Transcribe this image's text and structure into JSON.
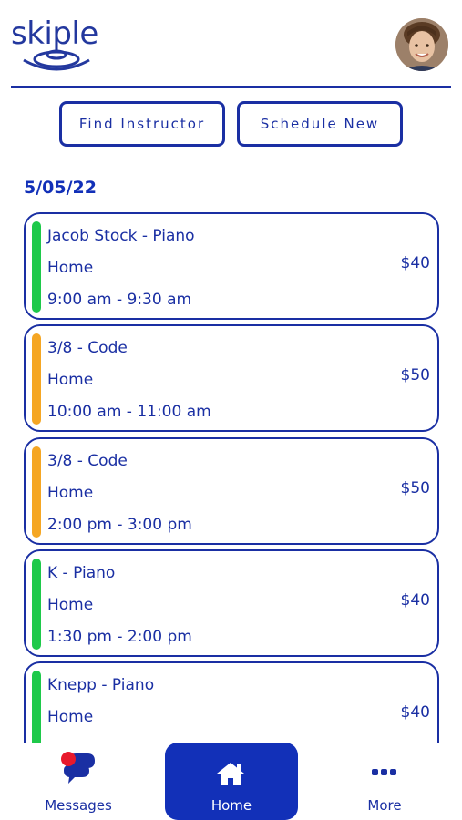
{
  "header": {
    "logo_text": "skiple",
    "avatar": "user-avatar"
  },
  "actions": {
    "find_instructor": "Find Instructor",
    "schedule_new": "Schedule New"
  },
  "date": "5/05/22",
  "appointments": [
    {
      "title": "Jacob Stock - Piano",
      "location": "Home",
      "time": "9:00 am - 9:30 am",
      "price": "$40",
      "status_color": "#1ec94a"
    },
    {
      "title": "3/8 - Code",
      "location": "Home",
      "time": "10:00 am - 11:00 am",
      "price": "$50",
      "status_color": "#f5a623"
    },
    {
      "title": "3/8 - Code",
      "location": "Home",
      "time": "2:00 pm - 3:00 pm",
      "price": "$50",
      "status_color": "#f5a623"
    },
    {
      "title": "K - Piano",
      "location": "Home",
      "time": "1:30 pm - 2:00 pm",
      "price": "$40",
      "status_color": "#1ec94a"
    },
    {
      "title": "Knepp - Piano",
      "location": "Home",
      "time": "",
      "price": "$40",
      "status_color": "#1ec94a"
    }
  ],
  "nav": {
    "messages": "Messages",
    "home": "Home",
    "more": "More"
  },
  "colors": {
    "brand": "#1a2fa3",
    "active_nav": "#1230b8",
    "notification": "#e8192c"
  }
}
